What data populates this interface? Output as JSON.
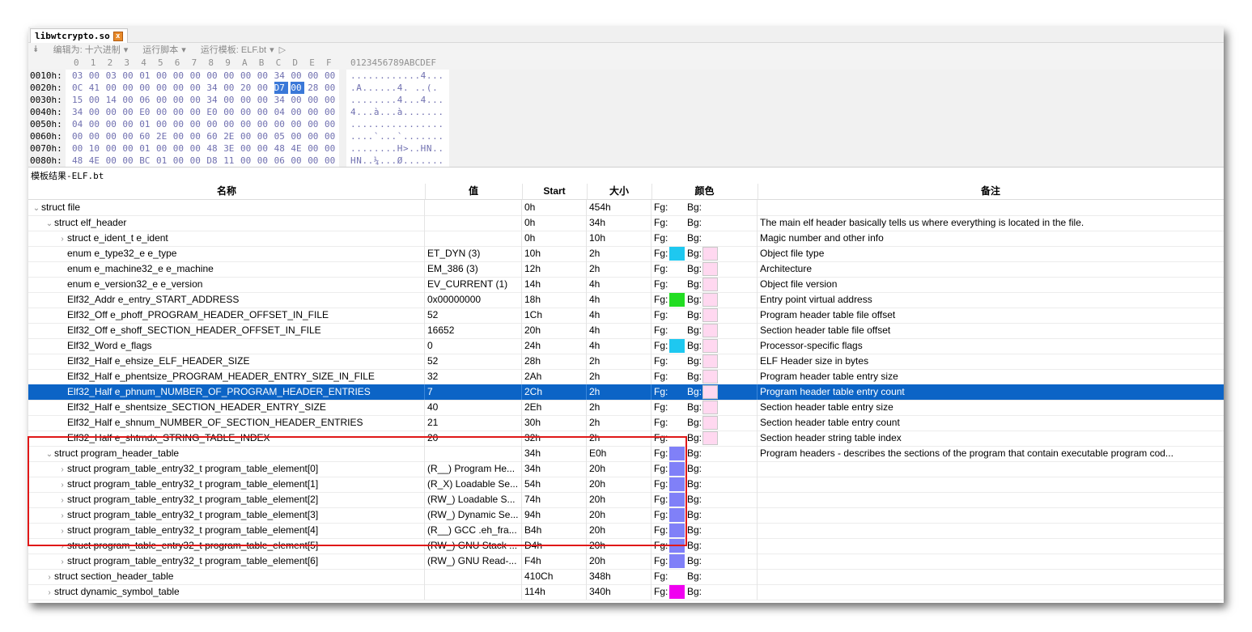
{
  "tab": {
    "title": "libwtcrypto.so",
    "close": "x"
  },
  "toolbar": {
    "pin": "⯯",
    "edit_as": "编辑为: 十六进制",
    "run_script": "运行脚本",
    "run_template": "运行模板: ELF.bt",
    "play": "▷"
  },
  "hex": {
    "col_header": [
      "0",
      "1",
      "2",
      "3",
      "4",
      "5",
      "6",
      "7",
      "8",
      "9",
      "A",
      "B",
      "C",
      "D",
      "E",
      "F"
    ],
    "ascii_header": "0123456789ABCDEF",
    "rows": [
      {
        "addr": "0010h:",
        "bytes": [
          "03",
          "00",
          "03",
          "00",
          "01",
          "00",
          "00",
          "00",
          "00",
          "00",
          "00",
          "00",
          "34",
          "00",
          "00",
          "00"
        ],
        "ascii": "............4..."
      },
      {
        "addr": "0020h:",
        "bytes": [
          "0C",
          "41",
          "00",
          "00",
          "00",
          "00",
          "00",
          "00",
          "34",
          "00",
          "20",
          "00",
          "D7",
          "00",
          "28",
          "00"
        ],
        "ascii": ".A......4. ..(."
      },
      {
        "addr": "0030h:",
        "bytes": [
          "15",
          "00",
          "14",
          "00",
          "06",
          "00",
          "00",
          "00",
          "34",
          "00",
          "00",
          "00",
          "34",
          "00",
          "00",
          "00"
        ],
        "ascii": "........4...4..."
      },
      {
        "addr": "0040h:",
        "bytes": [
          "34",
          "00",
          "00",
          "00",
          "E0",
          "00",
          "00",
          "00",
          "E0",
          "00",
          "00",
          "00",
          "04",
          "00",
          "00",
          "00"
        ],
        "ascii": "4...à...à......."
      },
      {
        "addr": "0050h:",
        "bytes": [
          "04",
          "00",
          "00",
          "00",
          "01",
          "00",
          "00",
          "00",
          "00",
          "00",
          "00",
          "00",
          "00",
          "00",
          "00",
          "00"
        ],
        "ascii": "................"
      },
      {
        "addr": "0060h:",
        "bytes": [
          "00",
          "00",
          "00",
          "00",
          "60",
          "2E",
          "00",
          "00",
          "60",
          "2E",
          "00",
          "00",
          "05",
          "00",
          "00",
          "00"
        ],
        "ascii": "....`...`......."
      },
      {
        "addr": "0070h:",
        "bytes": [
          "00",
          "10",
          "00",
          "00",
          "01",
          "00",
          "00",
          "00",
          "48",
          "3E",
          "00",
          "00",
          "48",
          "4E",
          "00",
          "00"
        ],
        "ascii": "........H>..HN.."
      },
      {
        "addr": "0080h:",
        "bytes": [
          "48",
          "4E",
          "00",
          "00",
          "BC",
          "01",
          "00",
          "00",
          "D8",
          "11",
          "00",
          "00",
          "06",
          "00",
          "00",
          "00"
        ],
        "ascii": "HN..¼...Ø......."
      }
    ]
  },
  "results_label": "模板结果-ELF.bt",
  "table": {
    "headers": {
      "name": "名称",
      "value": "值",
      "start": "Start",
      "size": "大小",
      "color": "颜色",
      "comment": "备注"
    },
    "rows": [
      {
        "indent": 0,
        "caret": "⌄",
        "name": "struct file",
        "value": "",
        "start": "0h",
        "size": "454h",
        "fg": "Fg:",
        "bg": "Bg:",
        "fg_color": "",
        "bg_color": "",
        "comment": ""
      },
      {
        "indent": 1,
        "caret": "⌄",
        "name": "struct elf_header",
        "value": "",
        "start": "0h",
        "size": "34h",
        "fg": "Fg:",
        "bg": "Bg:",
        "fg_color": "",
        "bg_color": "",
        "comment": "The main elf header basically tells us where everything is located in the file."
      },
      {
        "indent": 2,
        "caret": "›",
        "name": "struct e_ident_t e_ident",
        "value": "",
        "start": "0h",
        "size": "10h",
        "fg": "Fg:",
        "bg": "Bg:",
        "fg_color": "",
        "bg_color": "",
        "comment": "Magic number and other info"
      },
      {
        "indent": 2,
        "caret": "",
        "name": "enum e_type32_e e_type",
        "value": "ET_DYN (3)",
        "start": "10h",
        "size": "2h",
        "fg": "Fg:",
        "bg": "Bg:",
        "fg_color": "#1ec8f0",
        "bg_color": "#ffd8f0",
        "comment": "Object file type"
      },
      {
        "indent": 2,
        "caret": "",
        "name": "enum e_machine32_e e_machine",
        "value": "EM_386 (3)",
        "start": "12h",
        "size": "2h",
        "fg": "Fg:",
        "bg": "Bg:",
        "fg_color": "",
        "bg_color": "#ffd8f0",
        "comment": "Architecture"
      },
      {
        "indent": 2,
        "caret": "",
        "name": "enum e_version32_e e_version",
        "value": "EV_CURRENT (1)",
        "start": "14h",
        "size": "4h",
        "fg": "Fg:",
        "bg": "Bg:",
        "fg_color": "",
        "bg_color": "#ffd8f0",
        "comment": "Object file version"
      },
      {
        "indent": 2,
        "caret": "",
        "name": "Elf32_Addr e_entry_START_ADDRESS",
        "value": "0x00000000",
        "start": "18h",
        "size": "4h",
        "fg": "Fg:",
        "bg": "Bg:",
        "fg_color": "#22dd22",
        "bg_color": "#ffd8f0",
        "comment": "Entry point virtual address"
      },
      {
        "indent": 2,
        "caret": "",
        "name": "Elf32_Off e_phoff_PROGRAM_HEADER_OFFSET_IN_FILE",
        "value": "52",
        "start": "1Ch",
        "size": "4h",
        "fg": "Fg:",
        "bg": "Bg:",
        "fg_color": "",
        "bg_color": "#ffd8f0",
        "comment": "Program header table file offset"
      },
      {
        "indent": 2,
        "caret": "",
        "name": "Elf32_Off e_shoff_SECTION_HEADER_OFFSET_IN_FILE",
        "value": "16652",
        "start": "20h",
        "size": "4h",
        "fg": "Fg:",
        "bg": "Bg:",
        "fg_color": "",
        "bg_color": "#ffd8f0",
        "comment": "Section header table file offset"
      },
      {
        "indent": 2,
        "caret": "",
        "name": "Elf32_Word e_flags",
        "value": "0",
        "start": "24h",
        "size": "4h",
        "fg": "Fg:",
        "bg": "Bg:",
        "fg_color": "#1ec8f0",
        "bg_color": "#ffd8f0",
        "comment": "Processor-specific flags"
      },
      {
        "indent": 2,
        "caret": "",
        "name": "Elf32_Half e_ehsize_ELF_HEADER_SIZE",
        "value": "52",
        "start": "28h",
        "size": "2h",
        "fg": "Fg:",
        "bg": "Bg:",
        "fg_color": "",
        "bg_color": "#ffd8f0",
        "comment": "ELF Header size in bytes"
      },
      {
        "indent": 2,
        "caret": "",
        "name": "Elf32_Half e_phentsize_PROGRAM_HEADER_ENTRY_SIZE_IN_FILE",
        "value": "32",
        "start": "2Ah",
        "size": "2h",
        "fg": "Fg:",
        "bg": "Bg:",
        "fg_color": "",
        "bg_color": "#ffd8f0",
        "comment": "Program header table entry size"
      },
      {
        "indent": 2,
        "caret": "",
        "name": "Elf32_Half e_phnum_NUMBER_OF_PROGRAM_HEADER_ENTRIES",
        "value": "7",
        "start": "2Ch",
        "size": "2h",
        "fg": "Fg:",
        "bg": "Bg:",
        "fg_color": "",
        "bg_color": "#ffd8f0",
        "comment": "Program header table entry count",
        "selected": true
      },
      {
        "indent": 2,
        "caret": "",
        "name": "Elf32_Half e_shentsize_SECTION_HEADER_ENTRY_SIZE",
        "value": "40",
        "start": "2Eh",
        "size": "2h",
        "fg": "Fg:",
        "bg": "Bg:",
        "fg_color": "",
        "bg_color": "#ffd8f0",
        "comment": "Section header table entry size"
      },
      {
        "indent": 2,
        "caret": "",
        "name": "Elf32_Half e_shnum_NUMBER_OF_SECTION_HEADER_ENTRIES",
        "value": "21",
        "start": "30h",
        "size": "2h",
        "fg": "Fg:",
        "bg": "Bg:",
        "fg_color": "",
        "bg_color": "#ffd8f0",
        "comment": "Section header table entry count"
      },
      {
        "indent": 2,
        "caret": "",
        "name": "Elf32_Half e_shtrndx_STRING_TABLE_INDEX",
        "value": "20",
        "start": "32h",
        "size": "2h",
        "fg": "Fg:",
        "bg": "Bg:",
        "fg_color": "",
        "bg_color": "#ffd8f0",
        "comment": "Section header string table index"
      },
      {
        "indent": 1,
        "caret": "⌄",
        "name": "struct program_header_table",
        "value": "",
        "start": "34h",
        "size": "E0h",
        "fg": "Fg:",
        "bg": "Bg:",
        "fg_color": "#8080f8",
        "bg_color": "",
        "comment": "Program headers - describes the sections of the program that contain executable program cod..."
      },
      {
        "indent": 2,
        "caret": "›",
        "name": "struct program_table_entry32_t program_table_element[0]",
        "value": "(R__) Program He...",
        "start": "34h",
        "size": "20h",
        "fg": "Fg:",
        "bg": "Bg:",
        "fg_color": "#8080f8",
        "bg_color": "",
        "comment": ""
      },
      {
        "indent": 2,
        "caret": "›",
        "name": "struct program_table_entry32_t program_table_element[1]",
        "value": "(R_X) Loadable Se...",
        "start": "54h",
        "size": "20h",
        "fg": "Fg:",
        "bg": "Bg:",
        "fg_color": "#8080f8",
        "bg_color": "",
        "comment": ""
      },
      {
        "indent": 2,
        "caret": "›",
        "name": "struct program_table_entry32_t program_table_element[2]",
        "value": "(RW_) Loadable S...",
        "start": "74h",
        "size": "20h",
        "fg": "Fg:",
        "bg": "Bg:",
        "fg_color": "#8080f8",
        "bg_color": "",
        "comment": ""
      },
      {
        "indent": 2,
        "caret": "›",
        "name": "struct program_table_entry32_t program_table_element[3]",
        "value": "(RW_) Dynamic Se...",
        "start": "94h",
        "size": "20h",
        "fg": "Fg:",
        "bg": "Bg:",
        "fg_color": "#8080f8",
        "bg_color": "",
        "comment": ""
      },
      {
        "indent": 2,
        "caret": "›",
        "name": "struct program_table_entry32_t program_table_element[4]",
        "value": "(R__) GCC .eh_fra...",
        "start": "B4h",
        "size": "20h",
        "fg": "Fg:",
        "bg": "Bg:",
        "fg_color": "#8080f8",
        "bg_color": "",
        "comment": ""
      },
      {
        "indent": 2,
        "caret": "›",
        "name": "struct program_table_entry32_t program_table_element[5]",
        "value": "(RW_) GNU Stack ...",
        "start": "D4h",
        "size": "20h",
        "fg": "Fg:",
        "bg": "Bg:",
        "fg_color": "#8080f8",
        "bg_color": "",
        "comment": ""
      },
      {
        "indent": 2,
        "caret": "›",
        "name": "struct program_table_entry32_t program_table_element[6]",
        "value": "(RW_) GNU Read-...",
        "start": "F4h",
        "size": "20h",
        "fg": "Fg:",
        "bg": "Bg:",
        "fg_color": "#8080f8",
        "bg_color": "",
        "comment": ""
      },
      {
        "indent": 1,
        "caret": "›",
        "name": "struct section_header_table",
        "value": "",
        "start": "410Ch",
        "size": "348h",
        "fg": "Fg:",
        "bg": "Bg:",
        "fg_color": "",
        "bg_color": "",
        "comment": ""
      },
      {
        "indent": 1,
        "caret": "›",
        "name": "struct dynamic_symbol_table",
        "value": "",
        "start": "114h",
        "size": "340h",
        "fg": "Fg:",
        "bg": "Bg:",
        "fg_color": "#f000f0",
        "bg_color": "",
        "comment": ""
      }
    ]
  },
  "colors": {
    "selection": "#0c64c6",
    "highlight_box": "#e01818"
  }
}
